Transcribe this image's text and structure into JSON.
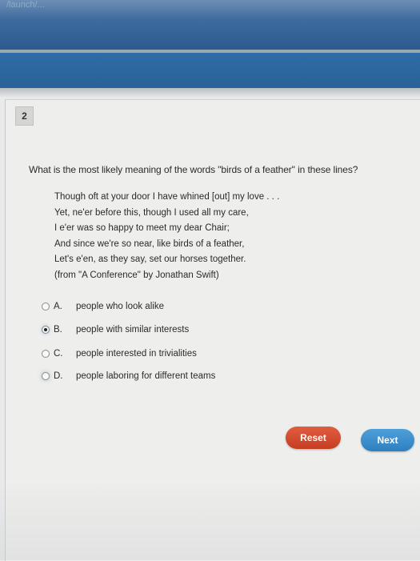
{
  "header": {
    "faded_text": "/launch/..."
  },
  "question": {
    "number": "2",
    "prompt": "What is the most likely meaning of the words \"birds of a feather\" in these lines?",
    "passage_lines": [
      "Though oft at your door I have whined [out] my love . . .",
      "Yet, ne'er before this, though I used all my care,",
      "I e'er was so happy to meet my dear Chair;",
      "And since we're so near, like birds of a feather,",
      "Let's e'en, as they say, set our horses together.",
      "(from \"A Conference\" by Jonathan Swift)"
    ]
  },
  "options": [
    {
      "letter": "A.",
      "text": "people who look alike",
      "selected": false
    },
    {
      "letter": "B.",
      "text": "people with similar interests",
      "selected": true
    },
    {
      "letter": "C.",
      "text": "people interested in trivialities",
      "selected": false
    },
    {
      "letter": "D.",
      "text": "people laboring for different teams",
      "selected": false
    }
  ],
  "buttons": {
    "reset_label": "Reset",
    "next_label": "Next"
  },
  "colors": {
    "reset": "#d24a2e",
    "next": "#3b8ccb",
    "header_blue": "#2f6ca5"
  }
}
